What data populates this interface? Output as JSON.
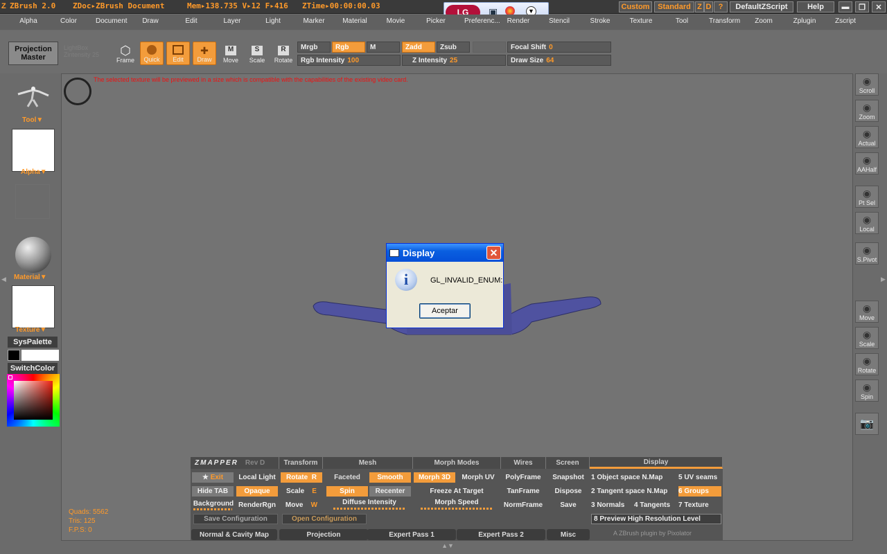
{
  "titlebar": {
    "app": "ZBrush 2.0",
    "doc": "ZDoc▸ZBrush Document",
    "mem": "Mem▸138.735 V▸12 F▸416",
    "ztime": "ZTime▸00:00:00.03",
    "lg_label": "LG",
    "buttons": [
      "Custom",
      "Standard",
      "Z",
      "D",
      "?"
    ],
    "script": "DefaultZScript",
    "help": "Help"
  },
  "menubar": [
    "Alpha",
    "Color",
    "Document",
    "Draw",
    "Edit",
    "Layer",
    "Light",
    "Marker",
    "Material",
    "Movie",
    "Picker",
    "Preferenc...",
    "Render",
    "Stencil",
    "Stroke",
    "Texture",
    "Tool",
    "Transform",
    "Zoom",
    "Zplugin",
    "Zscript"
  ],
  "shelf": {
    "projection_master": "Projection Master",
    "frame": "Frame",
    "quick": "Quick",
    "edit": "Edit",
    "draw": "Draw",
    "move": "Move",
    "scale": "Scale",
    "rotate": "Rotate",
    "mrgb": "Mrgb",
    "rgb": "Rgb",
    "m": "M",
    "zadd": "Zadd",
    "zsub": "Zsub",
    "rgb_intensity_label": "Rgb Intensity",
    "rgb_intensity_value": "100",
    "z_intensity_label": "Z Intensity",
    "z_intensity_value": "25",
    "focal_shift_label": "Focal Shift",
    "focal_shift_value": "0",
    "draw_size_label": "Draw Size",
    "draw_size_value": "64"
  },
  "left": {
    "tool": "Tool",
    "alpha": "Alpha",
    "material": "Material",
    "texture": "Texture",
    "syspalette": "SysPalette",
    "switchcolor": "SwitchColor"
  },
  "canvas": {
    "warning": "The selected texture will be previewed in a size which is compatible with the capabilities of the existing video card.",
    "stats": {
      "quads": "Quads: 5562",
      "tris": "Tris: 125",
      "fps": "F.P.S: 0"
    }
  },
  "right": [
    "Scroll",
    "Zoom",
    "Actual",
    "AAHalf",
    "Pt Sel",
    "Local",
    "S.Pivot",
    "Move",
    "Scale",
    "Rotate",
    "Spin"
  ],
  "zmapper": {
    "title": "ZMAPPER",
    "rev": "Rev D",
    "sections": [
      "Transform",
      "Mesh",
      "Morph Modes",
      "Wires",
      "Screen",
      "Display"
    ],
    "exit": "Exit",
    "local_light": "Local Light",
    "rotate": "Rotate",
    "rotate_key": "R",
    "faceted": "Faceted",
    "smooth": "Smooth",
    "morph3d": "Morph 3D",
    "morphuv": "Morph UV",
    "polyframe": "PolyFrame",
    "snapshot": "Snapshot",
    "hide_tab": "Hide TAB",
    "opaque": "Opaque",
    "scale": "Scale",
    "scale_key": "E",
    "spin": "Spin",
    "recenter": "Recenter",
    "freeze": "Freeze At Target",
    "tanframe": "TanFrame",
    "dispose": "Dispose",
    "background": "Background",
    "renderrgn": "RenderRgn",
    "move": "Move",
    "move_key": "W",
    "diffuse": "Diffuse Intensity",
    "morph_speed": "Morph Speed",
    "normframe": "NormFrame",
    "save": "Save",
    "display_items": [
      "1 Object space N.Map",
      "5 UV seams",
      "2 Tangent space N.Map",
      "6 Groups",
      "3 Normals",
      "4 Tangents",
      "7 Texture",
      "8 Preview High Resolution Level"
    ],
    "save_config": "Save Configuration",
    "open_config": "Open Configuration",
    "tabs": [
      "Normal & Cavity Map",
      "Projection",
      "Expert Pass 1",
      "Expert Pass 2",
      "Misc"
    ],
    "credit": "A ZBrush plugin by Pixolator"
  },
  "dialog": {
    "title": "Display",
    "message": "GL_INVALID_ENUM:",
    "ok": "Aceptar"
  },
  "colors": {
    "accent": "#f39c3b",
    "xp_blue": "#0a5fe0"
  }
}
